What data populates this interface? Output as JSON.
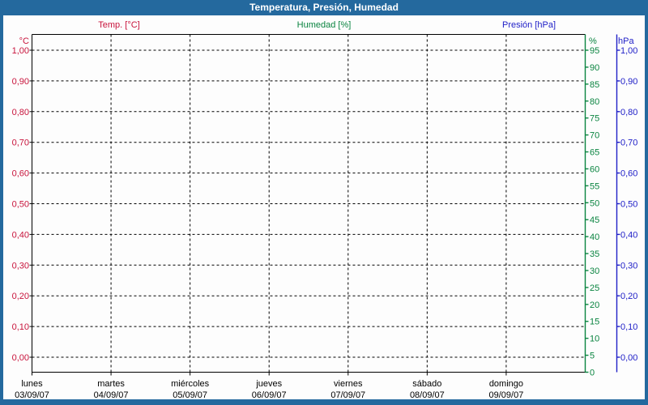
{
  "header": {
    "title": "Temperatura, Presión, Humedad"
  },
  "colors": {
    "frame_blue": "#24699e",
    "grid_black": "#000000",
    "temperature_red": "#c8143c",
    "humidity_green": "#0a8440",
    "pressure_blue": "#2121c8",
    "text_black": "#000000",
    "background": "#fdfdfd"
  },
  "legend": {
    "items": [
      {
        "label": "Temp. [°C]",
        "color": "#c8143c"
      },
      {
        "label": "Humedad [%]",
        "color": "#0a8440"
      },
      {
        "label": "Presión [hPa]",
        "color": "#2121c8"
      }
    ]
  },
  "chart_data": {
    "type": "line",
    "title": "Temperatura, Presión, Humedad",
    "grid": {
      "style": "dashed",
      "color": "#000000",
      "on": true
    },
    "series": [
      {
        "name": "Temp. [°C]",
        "axis": "temperature",
        "color": "#c8143c",
        "values": []
      },
      {
        "name": "Humedad [%]",
        "axis": "humidity",
        "color": "#0a8440",
        "values": []
      },
      {
        "name": "Presión [hPa]",
        "axis": "pressure",
        "color": "#2121c8",
        "values": []
      }
    ],
    "axes": {
      "temperature": {
        "unit": "°C",
        "side": "left",
        "color": "#c8143c",
        "range": [
          0.0,
          1.0
        ],
        "tick_labels": [
          "1,00",
          "0,90",
          "0,80",
          "0,70",
          "0,60",
          "0,50",
          "0,40",
          "0,30",
          "0,20",
          "0,10",
          "0,00"
        ]
      },
      "humidity": {
        "unit": "%",
        "side": "right-inner",
        "color": "#0a8440",
        "range": [
          0,
          100
        ],
        "tick_labels": [
          "95",
          "90",
          "85",
          "80",
          "75",
          "70",
          "65",
          "60",
          "55",
          "50",
          "45",
          "40",
          "35",
          "30",
          "25",
          "20",
          "15",
          "10",
          "5",
          "0"
        ]
      },
      "pressure": {
        "unit": "hPa",
        "side": "right-outer",
        "color": "#2121c8",
        "range": [
          0.0,
          1.0
        ],
        "tick_labels": [
          "1,00",
          "0,90",
          "0,80",
          "0,70",
          "0,60",
          "0,50",
          "0,40",
          "0,30",
          "0,20",
          "0,10",
          "0,00"
        ]
      },
      "x": {
        "side": "bottom",
        "color": "#000000",
        "days": [
          {
            "name": "lunes",
            "date": "03/09/07"
          },
          {
            "name": "martes",
            "date": "04/09/07"
          },
          {
            "name": "miércoles",
            "date": "05/09/07"
          },
          {
            "name": "jueves",
            "date": "06/09/07"
          },
          {
            "name": "viernes",
            "date": "07/09/07"
          },
          {
            "name": "sábado",
            "date": "08/09/07"
          },
          {
            "name": "domingo",
            "date": "09/09/07"
          }
        ]
      }
    }
  }
}
